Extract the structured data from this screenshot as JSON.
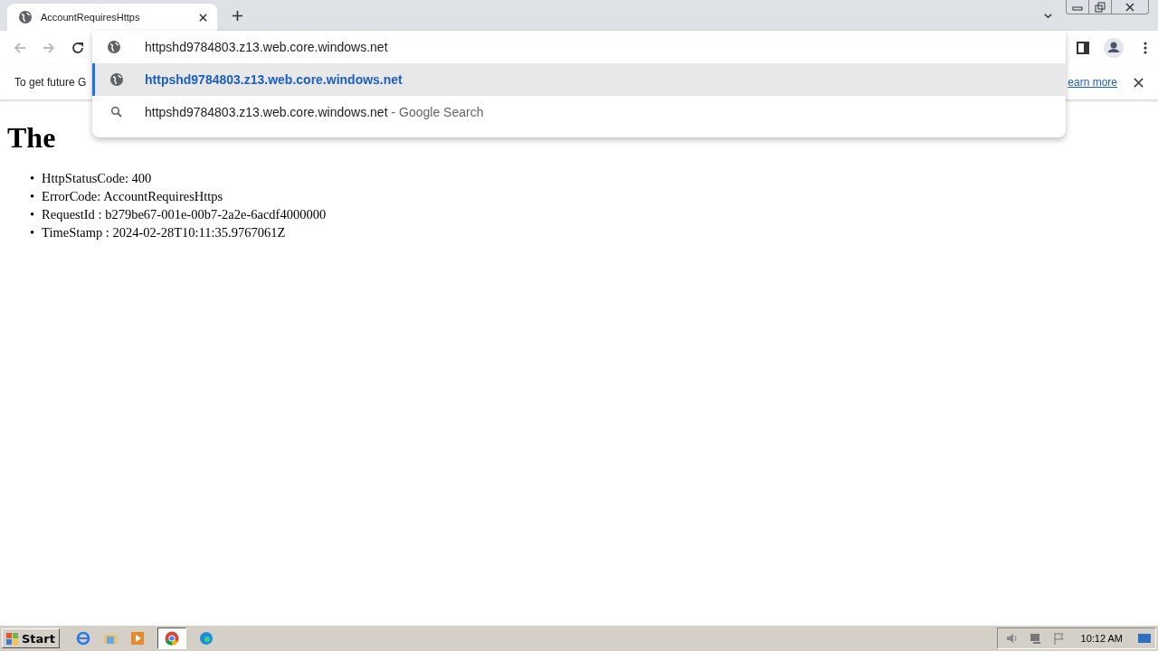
{
  "browser": {
    "tab": {
      "title": "AccountRequiresHttps"
    },
    "omnibox": {
      "value": "httpshd9784803.z13.web.core.windows.net"
    },
    "suggestions": [
      {
        "kind": "url",
        "text": "httpshd9784803.z13.web.core.windows.net",
        "selected": true
      },
      {
        "kind": "search",
        "text": "httpshd9784803.z13.web.core.windows.net",
        "suffix": "- Google Search",
        "selected": false
      }
    ],
    "infobar": {
      "text": "To get future G",
      "link": "earn more"
    }
  },
  "page": {
    "heading": "The",
    "items": [
      {
        "bullet": "•",
        "text": "HttpStatusCode: 400"
      },
      {
        "bullet": "•",
        "text": "ErrorCode: AccountRequiresHttps"
      },
      {
        "bullet": "•",
        "text": "RequestId : b279be67-001e-00b7-2a2e-6acdf4000000"
      },
      {
        "bullet": "•",
        "text": "TimeStamp : 2024-02-28T10:11:35.9767061Z"
      }
    ]
  },
  "taskbar": {
    "start": "Start",
    "clock": "10:12 AM"
  }
}
